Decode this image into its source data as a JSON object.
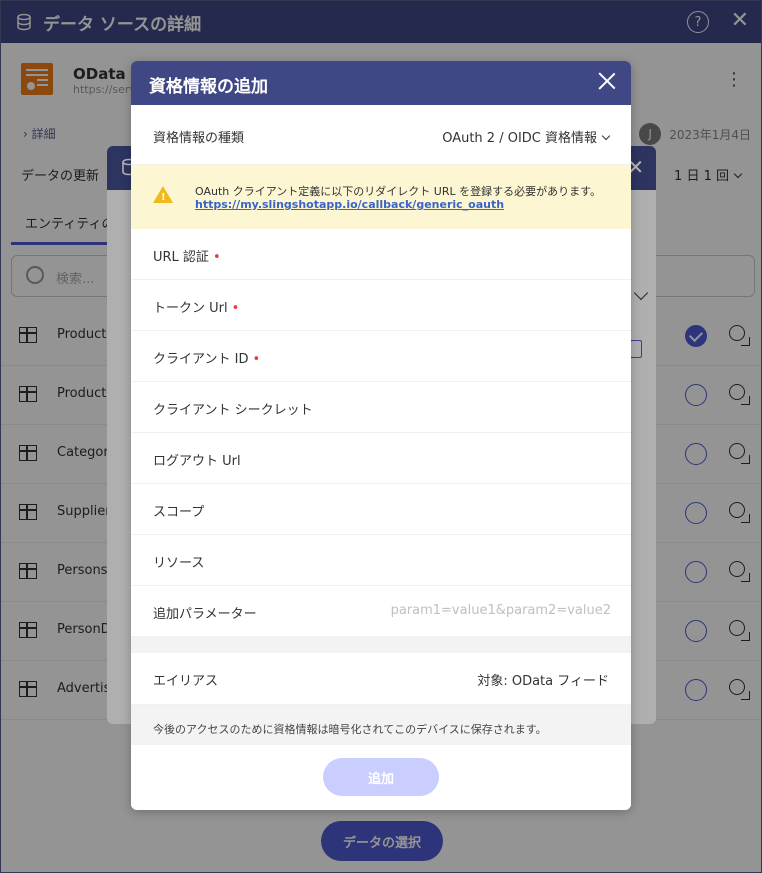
{
  "window": {
    "title": "データ ソースの詳細"
  },
  "source": {
    "name": "OData フ",
    "url": "https://serv"
  },
  "breadcrumb": "詳細",
  "meta": {
    "avatar_initial": "J",
    "date": "2023年1月4日"
  },
  "refresh": {
    "label": "データの更新",
    "frequency": "1 日 1 回"
  },
  "tab": {
    "label": "エンティティのセ"
  },
  "search": {
    "placeholder": "検索..."
  },
  "entities": [
    {
      "name": "Product",
      "selected": true
    },
    {
      "name": "Product",
      "selected": false
    },
    {
      "name": "Categor",
      "selected": false
    },
    {
      "name": "Supplier",
      "selected": false
    },
    {
      "name": "Persons",
      "selected": false
    },
    {
      "name": "PersonD",
      "selected": false
    },
    {
      "name": "Advertis",
      "selected": false
    }
  ],
  "select_data_button": "データの選択",
  "dialog": {
    "title": "資格情報の追加",
    "credential_type": {
      "label": "資格情報の種類",
      "value": "OAuth 2 / OIDC 資格情報"
    },
    "warning": {
      "text": "OAuth クライアント定義に以下のリダイレクト URL を登録する必要があります。",
      "link": "https://my.slingshotapp.io/callback/generic_oauth"
    },
    "fields": {
      "url_auth": "URL 認証",
      "token_url": "トークン Url",
      "client_id": "クライアント ID",
      "client_secret": "クライアント シークレット",
      "logout_url": "ログアウト Url",
      "scope": "スコープ",
      "resource": "リソース",
      "extra_params": "追加パラメーター",
      "extra_params_placeholder": "param1=value1&param2=value2"
    },
    "alias": {
      "label": "エイリアス",
      "value": "対象: OData フィード"
    },
    "note": "今後のアクセスのために資格情報は暗号化されてこのデバイスに保存されます。",
    "add_button": "追加",
    "required_mark": "•"
  }
}
